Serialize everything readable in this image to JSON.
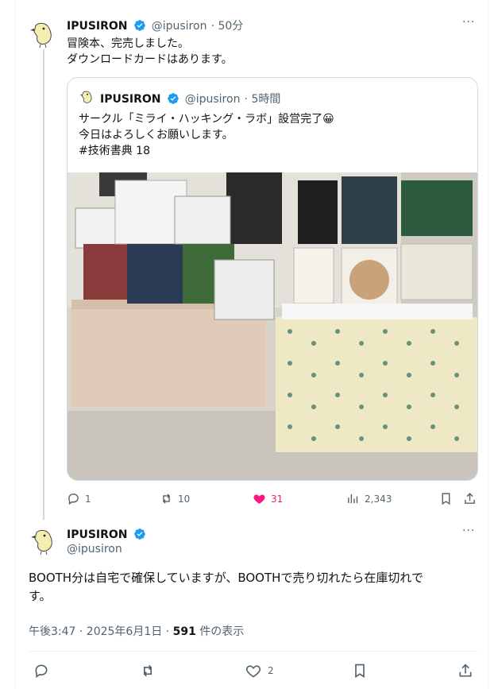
{
  "tweet1": {
    "name": "IPUSIRON",
    "handle": "@ipusiron",
    "time": "· 50分",
    "more": "···",
    "text": "冒険本、完売しました。\nダウンロードカードはあります。"
  },
  "quote": {
    "name": "IPUSIRON",
    "handle": "@ipusiron",
    "time": "· 5時間",
    "text": "サークル「ミライ・ハッキング・ラボ」設営完了😀\n今日はよろしくお願いします。\n#技術書典 18"
  },
  "tweet1_actions": {
    "replies": "1",
    "reposts": "10",
    "likes": "31",
    "views": "2,343"
  },
  "tweet2": {
    "name": "IPUSIRON",
    "handle": "@ipusiron",
    "more": "···",
    "text": "BOOTH分は自宅で確保していますが、BOOTHで売り切れたら在庫切れで\nす。",
    "time_label": "午後3:47 · 2025年6月1日 · ",
    "views_count": "591",
    "views_label": " 件の表示"
  },
  "tweet2_actions": {
    "likes": "2"
  },
  "colors": {
    "verified": "#1d9bf0",
    "like_active": "#f91880",
    "secondary_text": "#536471"
  }
}
